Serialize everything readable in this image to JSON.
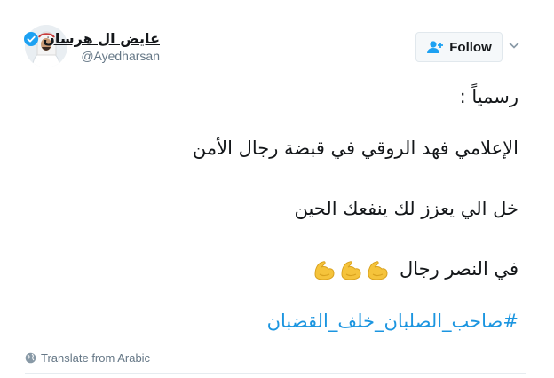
{
  "user": {
    "display_name": "عايض ال هرسان",
    "handle": "@Ayedharsan",
    "verified": true
  },
  "actions": {
    "follow_label": "Follow"
  },
  "tweet": {
    "line1": "رسمياً :",
    "line2": "الإعلامي فهد الروقي في قبضة رجال الأمن",
    "line3": "خل الي يعزز لك ينفعك الحين",
    "line4": "في النصر رجال",
    "emojis": [
      "flexed-biceps",
      "flexed-biceps",
      "flexed-biceps"
    ],
    "hashtag": "#صاحب_الصلبان_خلف_القضبان"
  },
  "footer": {
    "translate_label": "Translate from Arabic"
  },
  "colors": {
    "link": "#1b95e0",
    "text": "#14171a",
    "muted": "#657786",
    "verified": "#1da1f2",
    "emoji": "#f5c33b"
  }
}
